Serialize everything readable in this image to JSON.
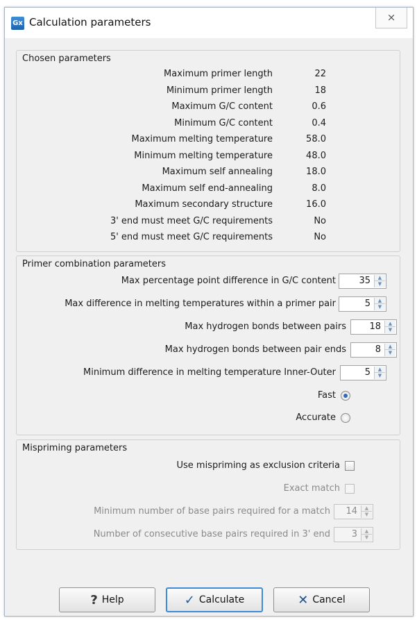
{
  "window": {
    "title": "Calculation parameters",
    "icon": "Gx",
    "close_glyph": "⨯"
  },
  "chosen": {
    "title": "Chosen parameters",
    "rows": [
      {
        "label": "Maximum primer length",
        "value": "22"
      },
      {
        "label": "Minimum primer length",
        "value": "18"
      },
      {
        "label": "Maximum G/C content",
        "value": "0.6"
      },
      {
        "label": "Minimum G/C content",
        "value": "0.4"
      },
      {
        "label": "Maximum melting temperature",
        "value": "58.0"
      },
      {
        "label": "Minimum melting temperature",
        "value": "48.0"
      },
      {
        "label": "Maximum self annealing",
        "value": "18.0"
      },
      {
        "label": "Maximum self end-annealing",
        "value": "8.0"
      },
      {
        "label": "Maximum secondary structure",
        "value": "16.0"
      },
      {
        "label": "3' end must meet G/C requirements",
        "value": "No"
      },
      {
        "label": "5' end must meet G/C requirements",
        "value": "No"
      }
    ]
  },
  "combination": {
    "title": "Primer combination parameters",
    "gc_diff": {
      "label": "Max percentage point difference in G/C content",
      "value": "35"
    },
    "tm_diff": {
      "label": "Max difference in melting temperatures within a primer pair",
      "value": "5"
    },
    "hbonds_pairs": {
      "label": "Max hydrogen bonds between pairs",
      "value": "18"
    },
    "hbonds_ends": {
      "label": "Max hydrogen bonds between pair ends",
      "value": "8"
    },
    "inner_outer": {
      "label": "Minimum difference in melting temperature Inner-Outer",
      "value": "5"
    },
    "fast_label": "Fast",
    "accurate_label": "Accurate",
    "selected_mode": "Fast"
  },
  "mispriming": {
    "title": "Mispriming parameters",
    "use_label": "Use mispriming as exclusion criteria",
    "exact_label": "Exact match",
    "min_bp": {
      "label": "Minimum number of base pairs required for a match",
      "value": "14"
    },
    "consecutive": {
      "label": "Number of consecutive base pairs required in 3' end",
      "value": "3"
    }
  },
  "buttons": {
    "help": {
      "label": "Help",
      "icon": "help-icon",
      "glyph": "?"
    },
    "calculate": {
      "label": "Calculate",
      "icon": "check-icon",
      "glyph": "✓"
    },
    "cancel": {
      "label": "Cancel",
      "icon": "cancel-icon",
      "glyph": "✕"
    }
  },
  "colors": {
    "accent": "#3c8ad8",
    "radio_selected": "#2d6cb0"
  }
}
